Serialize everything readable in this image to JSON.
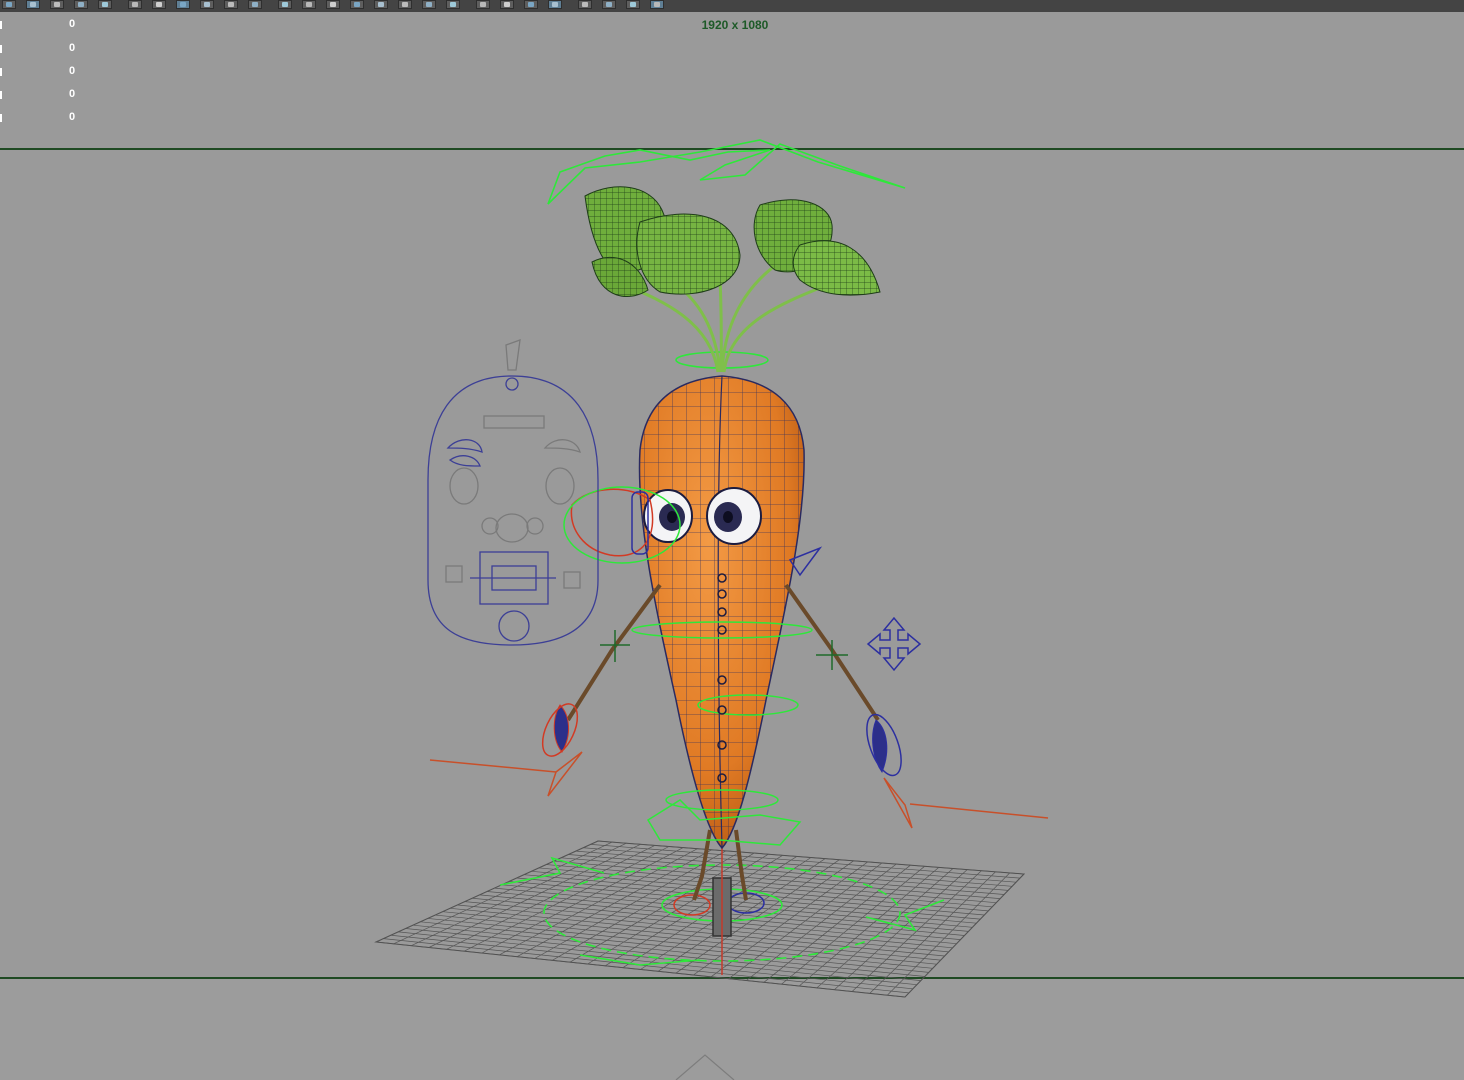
{
  "viewport": {
    "resolution_gate": "1920 x 1080",
    "hud_values": [
      "0",
      "0",
      "0",
      "0",
      "0"
    ]
  },
  "toolbar": {
    "icons": [
      "select-camera-icon",
      "camera-attributes-icon",
      "bookmark-icon",
      "image-plane-icon",
      "grid-icon",
      "film-gate-icon",
      "resolution-gate-icon",
      "gate-mask-icon",
      "field-chart-icon",
      "safe-action-icon",
      "wireframe-icon",
      "smooth-shade-icon",
      "default-material-icon",
      "textured-icon",
      "lights-icon",
      "shadows-icon",
      "ambient-occlusion-icon",
      "motion-blur-icon",
      "anti-aliasing-icon",
      "depth-of-field-icon",
      "isolate-select-icon",
      "xray-icon",
      "xray-joints-icon",
      "backface-icon",
      "exposure-icon",
      "gamma-icon",
      "color-management-icon"
    ]
  },
  "colors": {
    "viewport_bg": "#9a9a9a",
    "gate_line": "#1f4a23",
    "resolution_text": "#1e5a28",
    "carrot_body": "#e8832a",
    "leaves": "#6fae3c",
    "control_green": "#2ee83a",
    "control_blue": "#2c2fa0",
    "control_red": "#d23a24",
    "picker_outline": "#3c3f96"
  }
}
